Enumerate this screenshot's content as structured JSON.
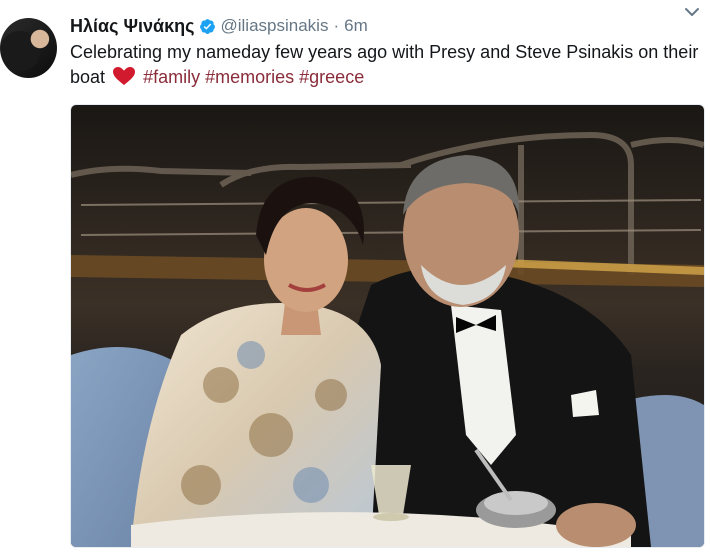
{
  "tweet": {
    "author_name": "Ηλίας Ψινάκης",
    "handle": "@iliaspsinakis",
    "separator": "·",
    "time": "6m",
    "text_before": "Celebrating my nameday few years ago with Presy and Steve Psinakis on their boat",
    "hashtags": [
      "#family",
      "#memories",
      "#greece"
    ]
  },
  "icons": {
    "verified": "verified-badge-icon",
    "heart": "red-heart-icon",
    "caret": "chevron-down-icon"
  },
  "colors": {
    "text": "#14171a",
    "muted": "#657786",
    "hashtag": "#8a2c3a",
    "verified": "#1da1f2",
    "heart": "#d21a2e"
  }
}
